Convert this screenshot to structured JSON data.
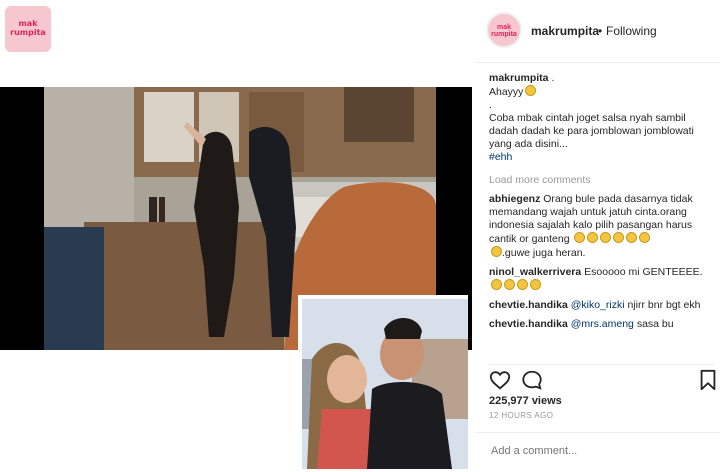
{
  "logo": {
    "text_top": "mak",
    "text_bottom": "rumpita"
  },
  "header": {
    "avatar_text": "mak rumpita",
    "username": "makrumpita",
    "separator": "•",
    "follow_status": "Following"
  },
  "caption": {
    "user": "makrumpita",
    "line1": ".",
    "line2": "Ahayyy",
    "line3": ".",
    "body": "Coba mbak cintah joget salsa nyah sambil dadah dadah ke para jomblowan jomblowati yang ada disini...",
    "hashtag": "#ehh"
  },
  "load_more": "Load more comments",
  "comments": [
    {
      "user": "abhiegenz",
      "text": "Orang bule pada dasarnya tidak memandang wajah untuk jatuh cinta.orang indonesia sajalah kalo pilih pasangan harus cantik or ganteng",
      "text2": ".guwe juga heran."
    },
    {
      "user": "ninol_walkerrivera",
      "text": "Esooooo mi GENTEEEE."
    },
    {
      "user": "chevtie.handika",
      "mention": "@kiko_rizki",
      "text": "njirr bnr bgt ekh"
    },
    {
      "user": "chevtie.handika",
      "mention": "@mrs.ameng",
      "text": "sasa bu"
    }
  ],
  "stats": {
    "views": "225,977 views",
    "time": "12 HOURS AGO"
  },
  "add_comment": {
    "placeholder": "Add a comment..."
  }
}
